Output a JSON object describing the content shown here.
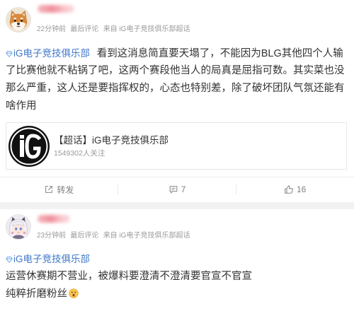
{
  "colors": {
    "text": "#333333",
    "link": "#3e77c8",
    "supertopic_icon": "#6fa8e6",
    "meta": "#9a9a9a",
    "action": "#808080",
    "feed_gap": "#f2f2f2",
    "card_border": "#e6e6e6",
    "username_blur": "#ef8e9a"
  },
  "posts": [
    {
      "icons": {
        "avatar": "shiba-dog-avatar-icon",
        "topic": "supertopic-diamond-icon",
        "card_logo": "ig-club-logo",
        "repost": "repost-icon",
        "comment": "comment-icon",
        "like": "thumbs-up-icon"
      },
      "meta": {
        "time": "22分钟前",
        "last_comment": "最后评论",
        "source": "来自 iG电子竞技俱乐部超话"
      },
      "topic_tag": "iG电子竞技俱乐部",
      "body_lines": [
        "看到这消息简直要天塌了，不能因为BLG其他四个人输",
        "了比赛他就不粘锅了吧，这两个赛段他当人的局真是屈指可数。其实菜也没",
        "那么严重，这人还是要指挥权的，心态也特别差，除了破坏团队气氛还能有",
        "啥作用"
      ],
      "card": {
        "title": "【超话】iG电子竞技俱乐部",
        "followers": "1549302人关注"
      },
      "actions": {
        "repost_label": "转发",
        "comment_count": "7",
        "like_count": "16"
      }
    },
    {
      "icons": {
        "avatar": "anime-character-avatar-icon",
        "topic": "supertopic-diamond-icon",
        "emoji": "surprised-face-emoji-icon"
      },
      "meta": {
        "time": "23分钟前",
        "last_comment": "最后评论",
        "source": "来自 iG电子竞技俱乐部超话"
      },
      "topic_tag": "iG电子竞技俱乐部",
      "body_lines": [
        "运营休赛期不营业，被爆料要澄清不澄清要官宣不官宣",
        "纯粹折磨粉丝"
      ]
    }
  ]
}
